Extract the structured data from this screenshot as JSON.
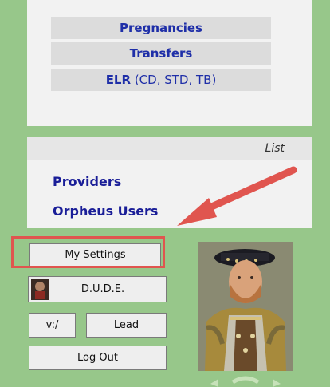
{
  "menu": {
    "pregnancies": "Pregnancies",
    "transfers": "Transfers",
    "elr_label": "ELR",
    "elr_note": " (CD, STD, TB)"
  },
  "list": {
    "header": "List",
    "providers": "Providers",
    "orpheus_users": "Orpheus Users"
  },
  "buttons": {
    "my_settings": "My Settings",
    "dude": "D.U.D.E.",
    "v_drive": "v:/",
    "lead": "Lead",
    "log_out": "Log Out"
  },
  "colors": {
    "background": "#97c78a",
    "link": "#1f2fa8",
    "annotation": "#e0554f"
  }
}
